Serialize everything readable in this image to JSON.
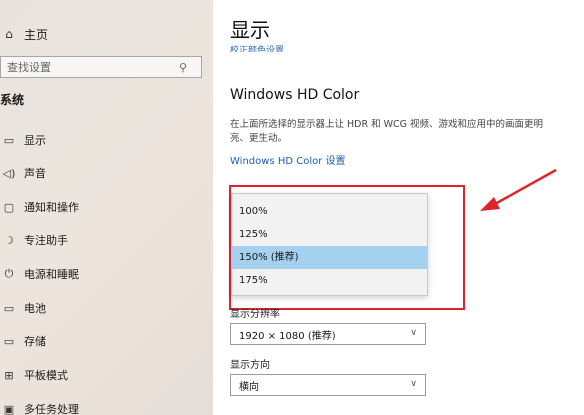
{
  "sidebar": {
    "home": {
      "icon": "home-icon",
      "label": "主页"
    },
    "search": {
      "placeholder": "查找设置",
      "icon": "search-icon"
    },
    "section_title": "系统",
    "items": [
      {
        "icon": "monitor-icon",
        "label": "显示"
      },
      {
        "icon": "speaker-icon",
        "label": "声音"
      },
      {
        "icon": "notification-icon",
        "label": "通知和操作"
      },
      {
        "icon": "moon-icon",
        "label": "专注助手"
      },
      {
        "icon": "power-icon",
        "label": "电源和睡眠"
      },
      {
        "icon": "battery-icon",
        "label": "电池"
      },
      {
        "icon": "storage-icon",
        "label": "存储"
      },
      {
        "icon": "tablet-icon",
        "label": "平板模式"
      },
      {
        "icon": "multitask-icon",
        "label": "多任务处理"
      }
    ]
  },
  "main": {
    "title": "显示",
    "sub_link": "校正颜色设置",
    "hd_color": {
      "title": "Windows HD Color",
      "description": "在上面所选择的显示器上让 HDR 和 WCG 视频、游戏和应用中的画面更明亮、更生动。",
      "link": "Windows HD Color 设置"
    },
    "scale_dropdown": {
      "options": [
        "100%",
        "125%",
        "150% (推荐)",
        "175%"
      ],
      "selected_index": 2
    },
    "resolution": {
      "label": "显示分辨率",
      "value": "1920 × 1080 (推荐)"
    },
    "orientation": {
      "label": "显示方向",
      "value": "横向"
    }
  },
  "colors": {
    "highlight_box": "#e0232b",
    "arrow": "#e0232b",
    "selected_option": "#a5d0f0",
    "link": "#1c5fb0"
  }
}
